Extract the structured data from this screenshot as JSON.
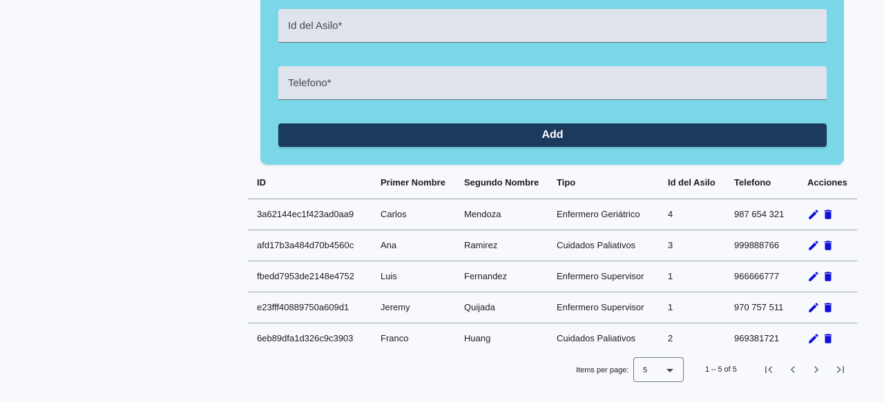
{
  "form": {
    "asilo_placeholder": "Id del Asilo*",
    "telefono_placeholder": "Telefono*",
    "add_label": "Add"
  },
  "table": {
    "headers": [
      "ID",
      "Primer Nombre",
      "Segundo Nombre",
      "Tipo",
      "Id del Asilo",
      "Telefono",
      "Acciones"
    ],
    "rows": [
      {
        "id": "3a62144ec1f423ad0aa9",
        "primer": "Carlos",
        "segundo": "Mendoza",
        "tipo": "Enfermero Geriátrico",
        "asilo": "4",
        "telefono": "987 654 321"
      },
      {
        "id": "afd17b3a484d70b4560c",
        "primer": "Ana",
        "segundo": "Ramirez",
        "tipo": "Cuidados Paliativos",
        "asilo": "3",
        "telefono": "999888766"
      },
      {
        "id": "fbedd7953de2148e4752",
        "primer": "Luis",
        "segundo": "Fernandez",
        "tipo": "Enfermero Supervisor",
        "asilo": "1",
        "telefono": "966666777"
      },
      {
        "id": "e23fff40889750a609d1",
        "primer": "Jeremy",
        "segundo": "Quijada",
        "tipo": "Enfermero Supervisor",
        "asilo": "1",
        "telefono": "970 757 511"
      },
      {
        "id": "6eb89dfa1d326c9c3903",
        "primer": "Franco",
        "segundo": "Huang",
        "tipo": "Cuidados Paliativos",
        "asilo": "2",
        "telefono": "969381721"
      }
    ],
    "row_icons": [
      "edit-icon",
      "delete-icon"
    ]
  },
  "paginator": {
    "items_per_page_label": "Items per page:",
    "page_size": "5",
    "range_label": "1 – 5 of 5",
    "icons": [
      "first-page-icon",
      "previous-page-icon",
      "next-page-icon",
      "last-page-icon"
    ]
  },
  "colors": {
    "page_background": "#f8f9fd",
    "form_card": "#79d7e8",
    "input_fill": "#dfe3ec",
    "add_button": "#1b3a5c",
    "action_icons": "#1010d8",
    "paginator_icons": "#6b7078"
  }
}
